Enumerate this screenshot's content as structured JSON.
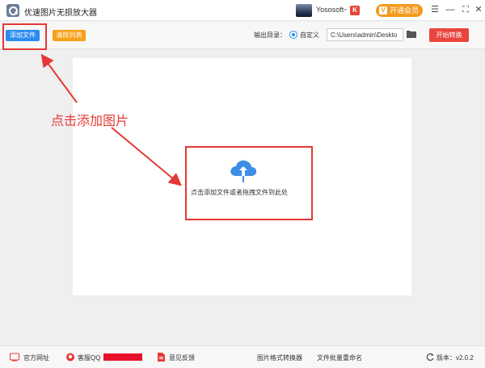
{
  "app": {
    "title": "优速图片无损放大器"
  },
  "user": {
    "name": "Yososoft",
    "caret": "⌄",
    "badge": "K",
    "vip_label": "开通会员",
    "vip_icon": "V"
  },
  "window_controls": {
    "menu": "☰",
    "minimize": "—",
    "maximize": "⛶",
    "close": "✕"
  },
  "toolbar": {
    "add_file_label": "添加文件",
    "clear_list_label": "清除列表",
    "output_label": "输出目录：",
    "custom_option_label": "自定义",
    "output_path": "C:\\Users\\admin\\Deskto",
    "start_label": "开始转换"
  },
  "drop_zone": {
    "hint": "点击添加文件或者拖拽文件到此处"
  },
  "annotation": {
    "label": "点击添加图片",
    "color": "#e53935"
  },
  "footer": {
    "website_label": "官方网址",
    "qq_label": "客服QQ",
    "feedback_label": "意见反馈",
    "converter_label": "图片格式转换器",
    "rename_label": "文件批量重命名",
    "version_label": "版本：v2.0.2"
  },
  "colors": {
    "accent_blue": "#2b8cf0",
    "accent_orange": "#f7a01a",
    "start_red": "#e8453c",
    "vip_orange": "#f39a1e"
  }
}
